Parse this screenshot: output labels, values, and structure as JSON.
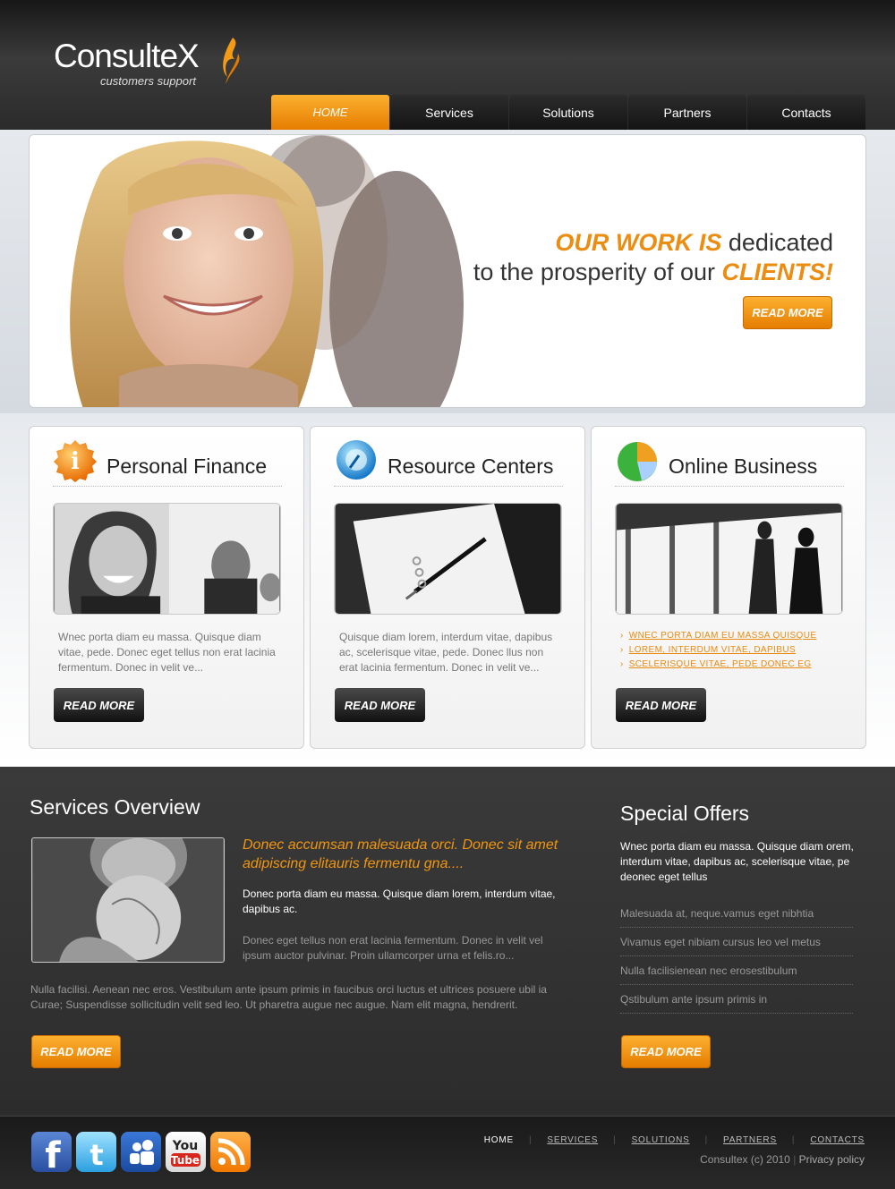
{
  "header": {
    "logo_title": "ConsulteX",
    "logo_sub": "customers support",
    "nav": [
      "HOME",
      "Services",
      "Solutions",
      "Partners",
      "Contacts"
    ]
  },
  "hero": {
    "line1_orange": "OUR WORK IS",
    "line1_rest": " dedicated",
    "line2_start": "to the prosperity of our ",
    "line2_orange": "CLIENTS!",
    "button": "READ MORE"
  },
  "cards": [
    {
      "title": "Personal Finance",
      "text": "Wnec porta diam eu massa. Quisque diam vitae, pede. Donec eget tellus non erat lacinia fermentum. Donec in velit ve...",
      "button": "READ MORE"
    },
    {
      "title": "Resource Centers",
      "text": "Quisque diam lorem, interdum vitae, dapibus ac, scelerisque vitae, pede. Donec llus non erat lacinia fermentum. Donec in velit ve...",
      "button": "READ MORE"
    },
    {
      "title": "Online Business",
      "links": [
        "WNEC PORTA DIAM EU MASSA QUISQUE",
        "LOREM, INTERDUM VITAE, DAPIBUS",
        "SCELERISQUE VITAE, PEDE DONEC EG"
      ],
      "button": "READ MORE"
    }
  ],
  "services": {
    "title": "Services Overview",
    "lead": "Donec accumsan malesuada orci. Donec sit amet adipiscing elitauris fermentu gna....",
    "p1": "Donec porta diam eu massa. Quisque diam lorem, interdum vitae, dapibus ac.",
    "p2": "Donec eget tellus non erat lacinia fermentum. Donec in velit vel ipsum auctor pulvinar. Proin ullamcorper urna et felis.ro...",
    "p3": "Nulla facilisi. Aenean nec eros. Vestibulum ante ipsum primis in faucibus orci luctus et ultrices posuere ubil ia Curae; Suspendisse sollicitudin velit sed leo. Ut pharetra augue nec augue. Nam elit magna, hendrerit.",
    "button": "READ MORE"
  },
  "offers": {
    "title": "Special Offers",
    "intro": "Wnec porta diam eu massa. Quisque diam orem, interdum vitae, dapibus ac, scelerisque vitae, pe deonec eget tellus",
    "items": [
      "Malesuada at, neque.vamus eget nibhtia",
      "Vivamus eget nibiam cursus leo vel metus",
      "Nulla facilisienean nec erosestibulum",
      "Qstibulum ante ipsum primis in"
    ],
    "button": "READ MORE"
  },
  "footer": {
    "nav": [
      "HOME",
      "SERVICES",
      "SOLUTIONS",
      "PARTNERS",
      "CONTACTS"
    ],
    "copyright": "Consultex (c) 2010",
    "privacy": "Privacy policy",
    "social_icons": [
      "facebook-icon",
      "twitter-icon",
      "myspace-icon",
      "youtube-icon",
      "rss-icon"
    ]
  },
  "colors": {
    "accent": "#ec8c10",
    "dark": "#2c2c2c"
  }
}
